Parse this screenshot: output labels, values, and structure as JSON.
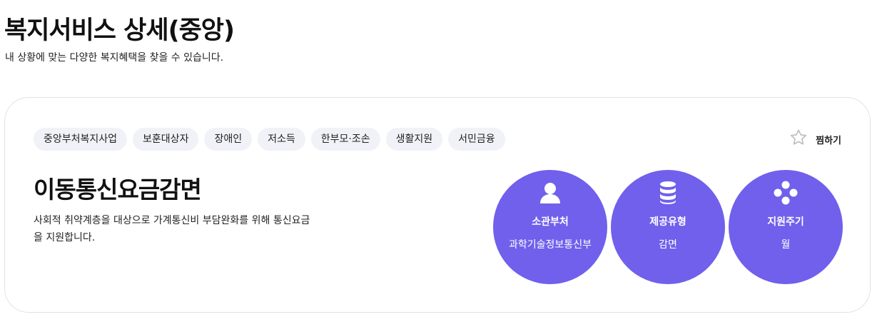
{
  "page": {
    "title": "복지서비스 상세(중앙)",
    "subtitle": "내 상황에 맞는 다양한 복지혜택을 찾을 수 있습니다."
  },
  "service": {
    "tags": [
      "중앙부처복지사업",
      "보훈대상자",
      "장애인",
      "저소득",
      "한부모·조손",
      "생활지원",
      "서민금융"
    ],
    "favorite_label": "찜하기",
    "title": "이동통신요금감면",
    "description": "사회적 취약계층을 대상으로 가계통신비 부담완화를 위해 통신요금을 지원합니다.",
    "info": [
      {
        "icon": "person-icon",
        "label": "소관부처",
        "value": "과학기술정보통신부"
      },
      {
        "icon": "database-icon",
        "label": "제공유형",
        "value": "감면"
      },
      {
        "icon": "cycle-icon",
        "label": "지원주기",
        "value": "월"
      }
    ]
  },
  "colors": {
    "accent": "#7060ec",
    "tag_bg": "#f1f1f8",
    "card_border": "#e2e2e2"
  }
}
